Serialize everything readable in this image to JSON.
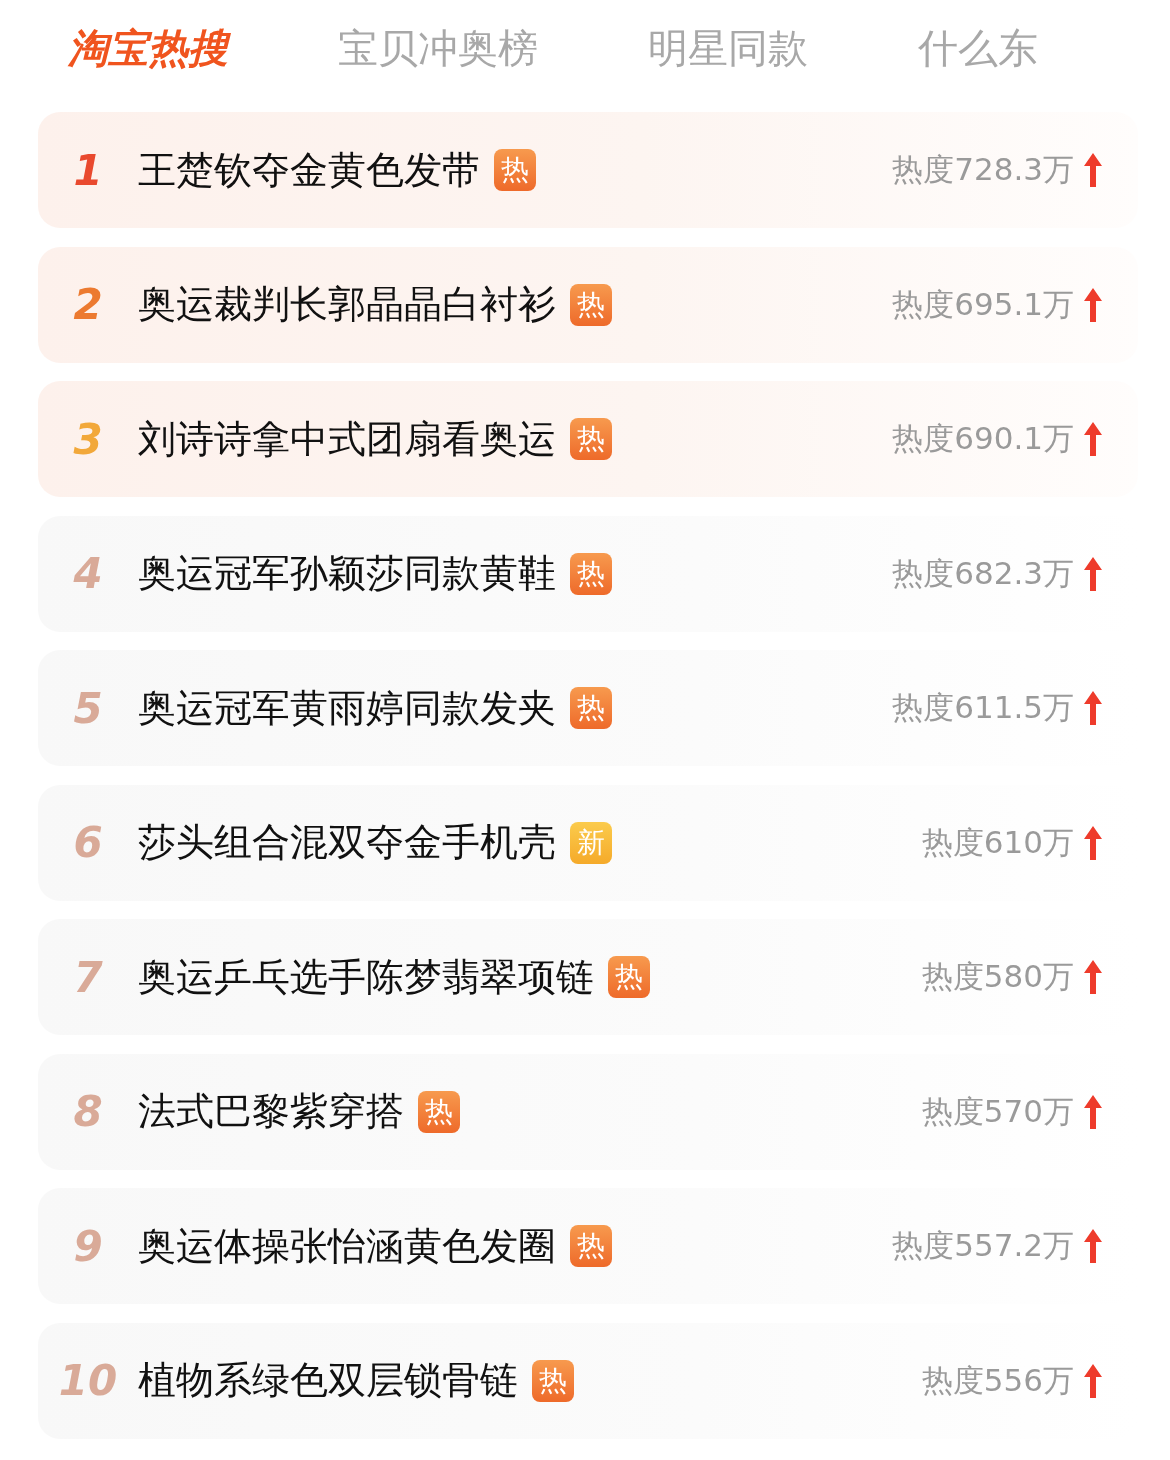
{
  "tabs": [
    {
      "label": "淘宝热搜",
      "selected": true
    },
    {
      "label": "宝贝冲奥榜",
      "selected": false
    },
    {
      "label": "明星同款",
      "selected": false
    },
    {
      "label": "什么东",
      "selected": false
    }
  ],
  "rows": [
    {
      "rank": "1",
      "color": "#e9492e",
      "top": true,
      "title": "王楚钦夺金黄色发带",
      "badge": {
        "kind": "hot",
        "text": "热"
      },
      "heat": "热度728.3万"
    },
    {
      "rank": "2",
      "color": "#ec7a30",
      "top": true,
      "title": "奥运裁判长郭晶晶白衬衫",
      "badge": {
        "kind": "hot",
        "text": "热"
      },
      "heat": "热度695.1万"
    },
    {
      "rank": "3",
      "color": "#f2a83a",
      "top": true,
      "title": "刘诗诗拿中式团扇看奥运",
      "badge": {
        "kind": "hot",
        "text": "热"
      },
      "heat": "热度690.1万"
    },
    {
      "rank": "4",
      "color": "#d9aa98",
      "top": false,
      "title": "奥运冠军孙颖莎同款黄鞋",
      "badge": {
        "kind": "hot",
        "text": "热"
      },
      "heat": "热度682.3万"
    },
    {
      "rank": "5",
      "color": "#d9aa98",
      "top": false,
      "title": "奥运冠军黄雨婷同款发夹",
      "badge": {
        "kind": "hot",
        "text": "热"
      },
      "heat": "热度611.5万"
    },
    {
      "rank": "6",
      "color": "#d9aa98",
      "top": false,
      "title": "莎头组合混双夺金手机壳",
      "badge": {
        "kind": "new",
        "text": "新"
      },
      "heat": "热度610万"
    },
    {
      "rank": "7",
      "color": "#d9aa98",
      "top": false,
      "title": "奥运乒乓选手陈梦翡翠项链",
      "badge": {
        "kind": "hot",
        "text": "热"
      },
      "heat": "热度580万"
    },
    {
      "rank": "8",
      "color": "#d9aa98",
      "top": false,
      "title": "法式巴黎紫穿搭",
      "badge": {
        "kind": "hot",
        "text": "热"
      },
      "heat": "热度570万"
    },
    {
      "rank": "9",
      "color": "#d9aa98",
      "top": false,
      "title": "奥运体操张怡涵黄色发圈",
      "badge": {
        "kind": "hot",
        "text": "热"
      },
      "heat": "热度557.2万"
    },
    {
      "rank": "10",
      "color": "#d9aa98",
      "top": false,
      "title": "植物系绿色双层锁骨链",
      "badge": {
        "kind": "hot",
        "text": "热"
      },
      "heat": "热度556万"
    }
  ]
}
